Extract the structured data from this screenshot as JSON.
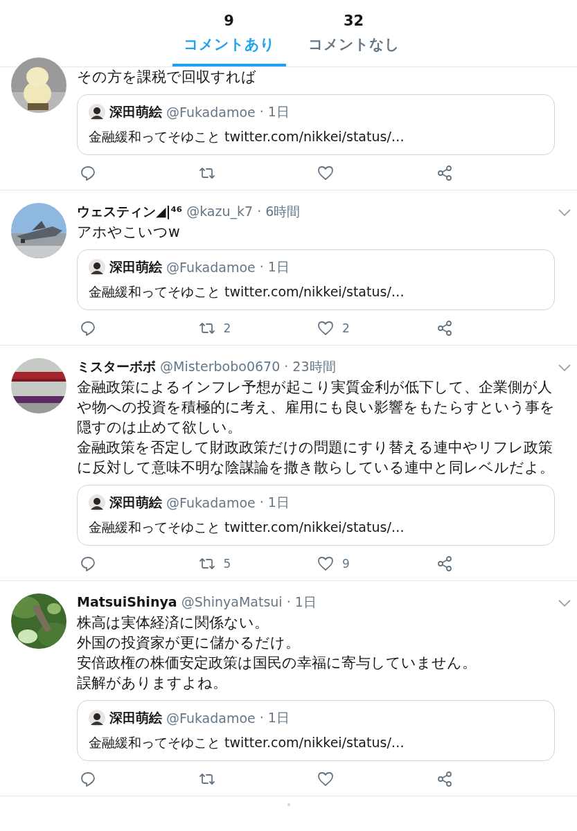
{
  "tabs": [
    {
      "count": "9",
      "label": "コメントあり",
      "selected": true
    },
    {
      "count": "32",
      "label": "コメントなし",
      "selected": false
    }
  ],
  "tweets": [
    {
      "lines": [
        "その方を課税で回収すれば"
      ],
      "quote": {
        "name": "深田萌絵",
        "handle": "@Fukadamoe",
        "time": "· 1日",
        "text": "金融緩和ってそゆこと twitter.com/nikkei/status/…"
      }
    },
    {
      "name": "ウェスティン◢|⁴⁶",
      "handle": "@kazu_k7",
      "time": "· 6時間",
      "lines": [
        "アホやこいつw"
      ],
      "quote": {
        "name": "深田萌絵",
        "handle": "@Fukadamoe",
        "time": "· 1日",
        "text": "金融緩和ってそゆこと twitter.com/nikkei/status/…"
      },
      "retweets": "2",
      "likes": "2"
    },
    {
      "name": "ミスターボボ",
      "handle": "@Misterbobo0670",
      "time": "· 23時間",
      "lines": [
        "金融政策によるインフレ予想が起こり実質金利が低下して、企業側が人や物への投資を積極的に考え、雇用にも良い影響をもたらすという事を隠すのは止めて欲しい。",
        "金融政策を否定して財政政策だけの問題にすり替える連中やリフレ政策に反対して意味不明な陰謀論を撒き散らしている連中と同レベルだよ。"
      ],
      "quote": {
        "name": "深田萌絵",
        "handle": "@Fukadamoe",
        "time": "· 1日",
        "text": "金融緩和ってそゆこと twitter.com/nikkei/status/…"
      },
      "retweets": "5",
      "likes": "9"
    },
    {
      "name": "MatsuiShinya",
      "handle": "@ShinyaMatsui",
      "time": "· 1日",
      "lines": [
        "株高は実体経済に関係ない。",
        "外国の投資家が更に儲かるだけ。",
        "安倍政権の株価安定政策は国民の幸福に寄与していません。",
        "誤解がありますよね。"
      ],
      "quote": {
        "name": "深田萌絵",
        "handle": "@Fukadamoe",
        "time": "· 1日",
        "text": "金融緩和ってそゆこと twitter.com/nikkei/status/…"
      }
    }
  ]
}
